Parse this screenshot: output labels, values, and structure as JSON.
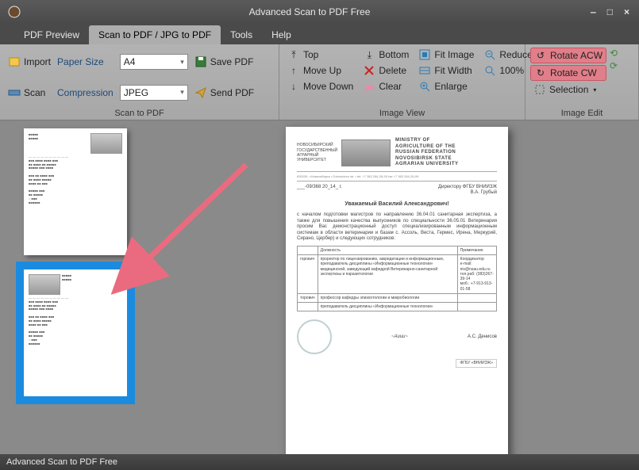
{
  "title": "Advanced Scan to PDF Free",
  "status": "Advanced Scan to PDF Free",
  "window": {
    "min": "‒",
    "max": "□",
    "close": "×"
  },
  "tabs": {
    "pdf_preview": "PDF Preview",
    "scan_to_pdf": "Scan to PDF / JPG to PDF",
    "tools": "Tools",
    "help": "Help"
  },
  "ribbon": {
    "group1": {
      "caption": "Scan to PDF",
      "import": "Import",
      "scan": "Scan",
      "paper_size_label": "Paper Size",
      "paper_size_value": "A4",
      "compression_label": "Compression",
      "compression_value": "JPEG",
      "save_pdf": "Save PDF",
      "send_pdf": "Send PDF"
    },
    "group2": {
      "caption": "Image View",
      "top": "Top",
      "move_up": "Move Up",
      "move_down": "Move Down",
      "bottom": "Bottom",
      "delete": "Delete",
      "clear": "Clear",
      "fit_image": "Fit Image",
      "fit_width": "Fit Width",
      "enlarge": "Enlarge",
      "reduce": "Reduce",
      "zoom": "100%"
    },
    "group3": {
      "caption": "Image Edit",
      "rotate_acw": "Rotate ACW",
      "rotate_cw": "Rotate CW",
      "selection": "Selection"
    }
  },
  "document": {
    "header_left": "НОВОСИБИРСКИЙ ГОСУДАРСТВЕННЫЙ АГРАРНЫЙ УНИВЕРСИТЕТ",
    "header_right": "MINISTRY OF AGRICULTURE OF THE RUSSIAN FEDERATION\nNOVOSIBIRSK STATE AGRARIAN UNIVERSITY",
    "date_line": "___-09/368   20_14_ г.",
    "addressee": "Директору ФГБУ ВНИИЗЖ\nВ.А. Грубый",
    "salutation": "Уважаемый Василий Александрович!",
    "body": "с началом подготовки магистров по направлению 36.04.01 санитарная экспертиза, а также для повышения качества выпускников по специальности 36.05.01 Ветеринария просим Вас демонстрационный доступ специализированным информационным системам в области ветеринарии и базам с. Ассоль, Веста, Гермес, Ирена, Меркурий, Сирано, Цербер) и следующих сотрудников:",
    "table": {
      "h1": "Должность",
      "h2": "Примечание",
      "r1c1": "горович",
      "r1c2": "проректор по лицензированию, аккредитации и информационным, преподаватель дисциплины «Информационные технологии» медицинской, заведующий кафедрой Ветеринарно-санитарной экспертизы и паразитологии",
      "r1c3": "Координатор\ne-mail: niv@nsau.edu.ru\nтел.раб: (383)267-39-14\nмоб.: +7-913-913-01-58",
      "r2c2": "профессор кафедры эпизоотологии и микробиологии",
      "r3c2": "преподаватель дисциплины «Информационные технологии»"
    },
    "signature_name": "А.С. Денисов",
    "footer": "ФГБУ «ВНИИЗЖ»"
  }
}
